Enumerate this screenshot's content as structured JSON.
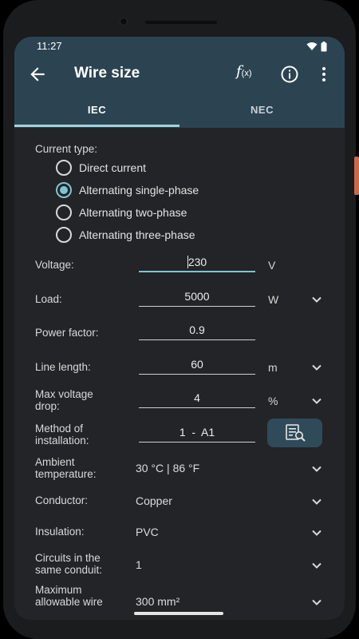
{
  "status": {
    "time": "11:27"
  },
  "appbar": {
    "title": "Wire size"
  },
  "tabs": [
    {
      "label": "IEC"
    },
    {
      "label": "NEC"
    }
  ],
  "current_type": {
    "label": "Current type:",
    "options": [
      {
        "label": "Direct current",
        "checked": false
      },
      {
        "label": "Alternating single-phase",
        "checked": true
      },
      {
        "label": "Alternating two-phase",
        "checked": false
      },
      {
        "label": "Alternating three-phase",
        "checked": false
      }
    ]
  },
  "fields": {
    "voltage": {
      "label": "Voltage:",
      "value": "230",
      "unit": "V"
    },
    "load": {
      "label": "Load:",
      "value": "5000",
      "unit": "W"
    },
    "power_factor": {
      "label": "Power factor:",
      "value": "0.9"
    },
    "line_length": {
      "label": "Line length:",
      "value": "60",
      "unit": "m"
    },
    "max_voltage_drop": {
      "label_line1": "Max voltage",
      "label_line2": "drop:",
      "value": "4",
      "unit": "%"
    },
    "method": {
      "label_line1": "Method of",
      "label_line2": "installation:",
      "value": "1  -  A1"
    }
  },
  "selects": {
    "ambient": {
      "label_line1": "Ambient",
      "label_line2": "temperature:",
      "value": "30 °C | 86 °F"
    },
    "conductor": {
      "label": "Conductor:",
      "value": "Copper"
    },
    "insulation": {
      "label": "Insulation:",
      "value": "PVC"
    },
    "circuits": {
      "label_line1": "Circuits in the",
      "label_line2": "same conduit:",
      "value": "1"
    },
    "max_wire": {
      "label_line1": "Maximum",
      "label_line2": "allowable wire",
      "value": "300 mm²"
    }
  },
  "colors": {
    "appbar": "#2c4452",
    "accent": "#7fc4d1",
    "background": "#222427"
  }
}
